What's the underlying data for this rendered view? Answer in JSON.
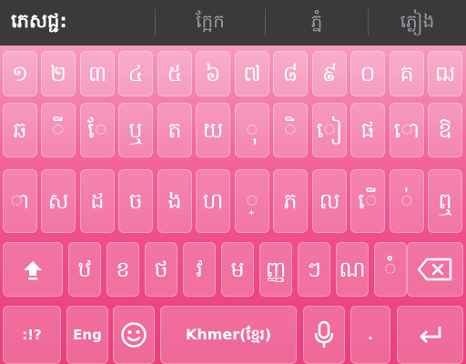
{
  "suggestions": [
    "ភេសជ្ជ:",
    "ក្អែក",
    "ភ្នំ",
    "ភ្លៀង"
  ],
  "rows": [
    [
      "១",
      "២",
      "៣",
      "៤",
      "៥",
      "៦",
      "៧",
      "៨",
      "៩",
      "០",
      "គ",
      "ឍ"
    ],
    [
      "ឆ",
      "ី",
      "ែ",
      "ឬ",
      "ត",
      "យ",
      "ុ",
      "ិ",
      "ៀ",
      "ផ",
      "ោ",
      "ឱ"
    ],
    [
      "ា",
      "ស",
      "ដ",
      "ច",
      "ង",
      "ហ",
      "្",
      "ភ",
      "ល",
      "ើ",
      "់",
      "ឮ"
    ],
    [
      "ឋ",
      "ខ",
      "ថ",
      "វ",
      "ម",
      "ញ្ញ",
      "ៗ",
      "ណ",
      "ំ"
    ]
  ],
  "bottom": {
    "symbols_label": ":!?",
    "lang_label": "Eng",
    "space_label": "Khmer(ខ្មែរ)",
    "period_label": "."
  },
  "icons": {
    "shift": "shift-arrow-icon",
    "backspace": "backspace-icon",
    "emoji": "emoji-smiley-icon",
    "mic": "microphone-icon",
    "enter": "enter-return-icon"
  },
  "colors": {
    "strip_bg": "#3a3a3c",
    "keyboard_top": "#f8b3ce",
    "keyboard_bottom": "#ea3f7c",
    "key_text": "#ffffff"
  }
}
